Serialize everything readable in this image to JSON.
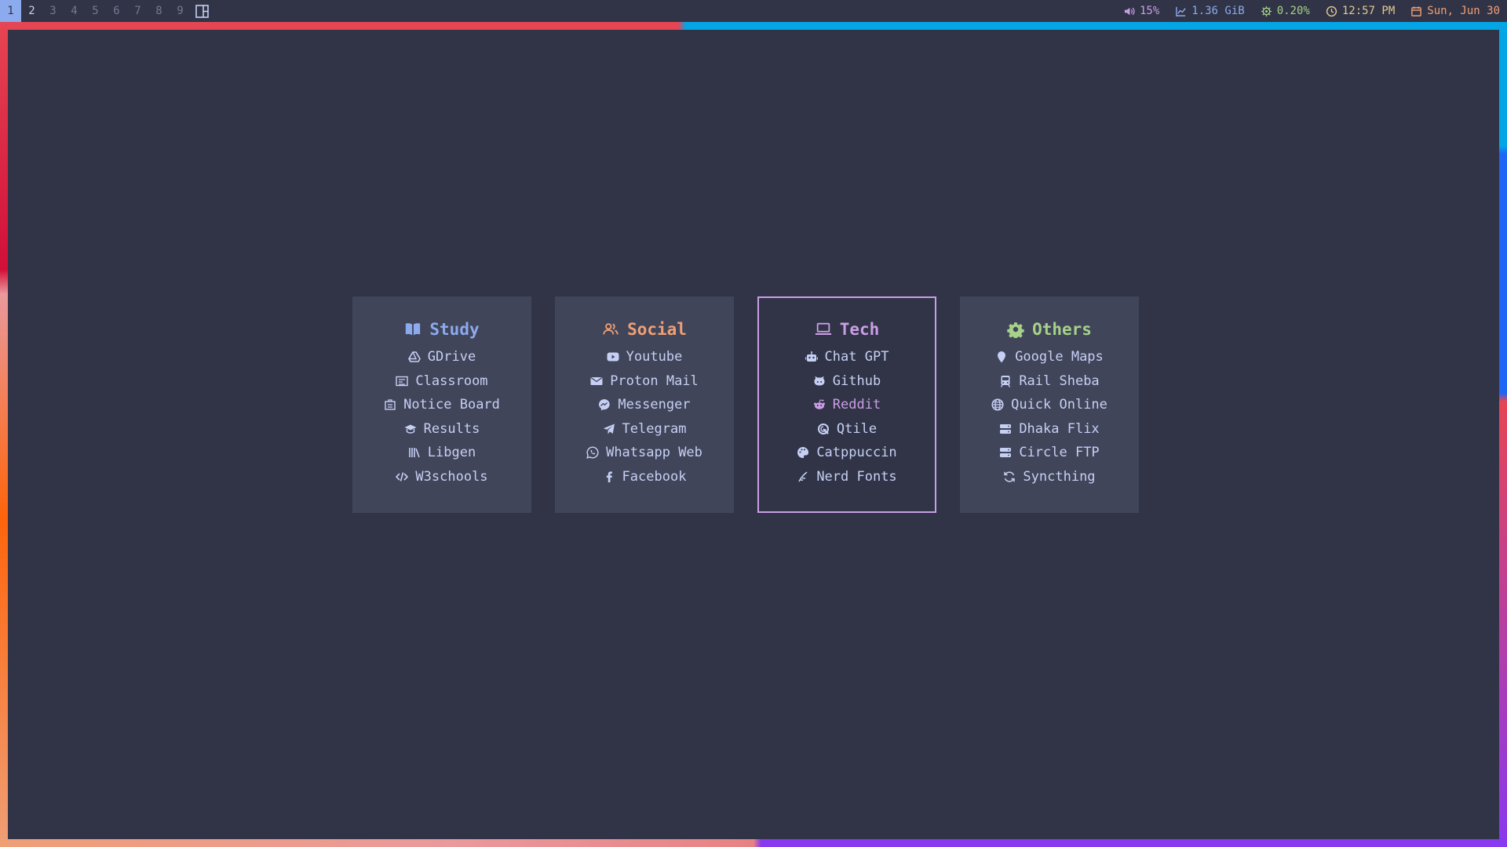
{
  "topbar": {
    "workspaces": [
      "1",
      "2",
      "3",
      "4",
      "5",
      "6",
      "7",
      "8",
      "9"
    ],
    "active_workspace": "1",
    "volume": "15%",
    "memory": "1.36 GiB",
    "cpu": "0.20%",
    "time": "12:57 PM",
    "date": "Sun, Jun 30",
    "colors": {
      "volume": "#ca9ee6",
      "memory": "#8caaee",
      "cpu": "#a6d189",
      "time": "#e5c890",
      "date": "#ef9f76"
    }
  },
  "cards": [
    {
      "title": "Study",
      "icon": "book-icon",
      "color": "#8caaee",
      "links": [
        {
          "label": "GDrive",
          "icon": "google-drive-icon"
        },
        {
          "label": "Classroom",
          "icon": "classroom-icon"
        },
        {
          "label": "Notice Board",
          "icon": "notice-board-icon"
        },
        {
          "label": "Results",
          "icon": "graduation-cap-icon"
        },
        {
          "label": "Libgen",
          "icon": "library-icon"
        },
        {
          "label": "W3schools",
          "icon": "code-icon"
        }
      ]
    },
    {
      "title": "Social",
      "icon": "users-icon",
      "color": "#ef9f76",
      "links": [
        {
          "label": "Youtube",
          "icon": "youtube-icon"
        },
        {
          "label": "Proton Mail",
          "icon": "envelope-icon"
        },
        {
          "label": "Messenger",
          "icon": "messenger-icon"
        },
        {
          "label": "Telegram",
          "icon": "telegram-icon"
        },
        {
          "label": "Whatsapp Web",
          "icon": "whatsapp-icon"
        },
        {
          "label": "Facebook",
          "icon": "facebook-icon"
        }
      ]
    },
    {
      "title": "Tech",
      "icon": "laptop-icon",
      "color": "#ca9ee6",
      "focused": true,
      "links": [
        {
          "label": "Chat GPT",
          "icon": "robot-icon"
        },
        {
          "label": "Github",
          "icon": "github-icon"
        },
        {
          "label": "Reddit",
          "icon": "reddit-icon",
          "hover": true
        },
        {
          "label": "Qtile",
          "icon": "qtile-icon"
        },
        {
          "label": "Catppuccin",
          "icon": "palette-icon"
        },
        {
          "label": "Nerd Fonts",
          "icon": "nerd-fonts-icon"
        }
      ]
    },
    {
      "title": "Others",
      "icon": "gear-icon",
      "color": "#a6d189",
      "links": [
        {
          "label": "Google Maps",
          "icon": "map-pin-icon"
        },
        {
          "label": "Rail Sheba",
          "icon": "train-icon"
        },
        {
          "label": "Quick Online",
          "icon": "globe-icon"
        },
        {
          "label": "Dhaka Flix",
          "icon": "server-icon"
        },
        {
          "label": "Circle FTP",
          "icon": "server-icon"
        },
        {
          "label": "Syncthing",
          "icon": "sync-icon"
        }
      ]
    }
  ]
}
